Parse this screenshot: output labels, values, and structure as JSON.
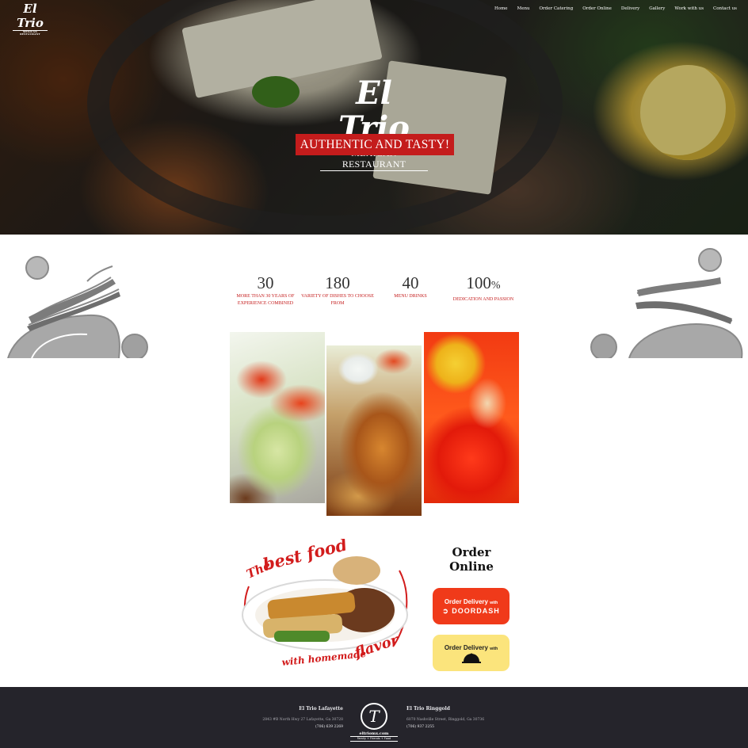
{
  "header": {
    "logo": {
      "name": "El Trio",
      "tagline": "MEXICAN RESTAURANT"
    },
    "nav": [
      "Home",
      "Menu",
      "Order Catering",
      "Order Online",
      "Delivery",
      "Gallery",
      "Work with us",
      "Contact us"
    ]
  },
  "hero": {
    "brand_name": "El Trio",
    "brand_sub": "MEXICAN RESTAURANT",
    "tagline": "AUTHENTIC AND TASTY!"
  },
  "stats": [
    {
      "number": "30",
      "suffix": "",
      "label": "MORE THAN 30 YEARS OF EXPERIENCE COMBINED"
    },
    {
      "number": "180",
      "suffix": "",
      "label": "VARIETY OF DISHES TO CHOOSE FROM"
    },
    {
      "number": "40",
      "suffix": "",
      "label": "MENU DRINKS"
    },
    {
      "number": "100",
      "suffix": "%",
      "label": "DEDICATION AND PASSION"
    }
  ],
  "promo": {
    "line1": "The",
    "line2": "best food",
    "line3": "with homemade",
    "line4": "flavor"
  },
  "order": {
    "title": "Order Online",
    "doordash": {
      "prefix": "Order Delivery",
      "with": "with",
      "brand": "DOORDASH"
    },
    "grubhub": {
      "prefix": "Order Delivery",
      "with": "with"
    }
  },
  "footer": {
    "lafayette": {
      "name": "El Trio Lafayette",
      "address": "2843 #B North Hwy 27 Lafayette, Ga 30728",
      "phone": "(706) 639 2269"
    },
    "ringgold": {
      "name": "El Trio Ringgold",
      "address": "6070 Nashville Street, Ringgold, Ga 30736",
      "phone": "(706) 937 2255"
    },
    "logo": {
      "letter": "T",
      "url": "eltriomx.com",
      "tagline": "Family + Friends + Food"
    }
  },
  "colors": {
    "accent_red": "#c41c1c",
    "doordash_red": "#f03a1a",
    "grubhub_yellow": "#fbe47c",
    "footer_bg": "#25242b"
  }
}
